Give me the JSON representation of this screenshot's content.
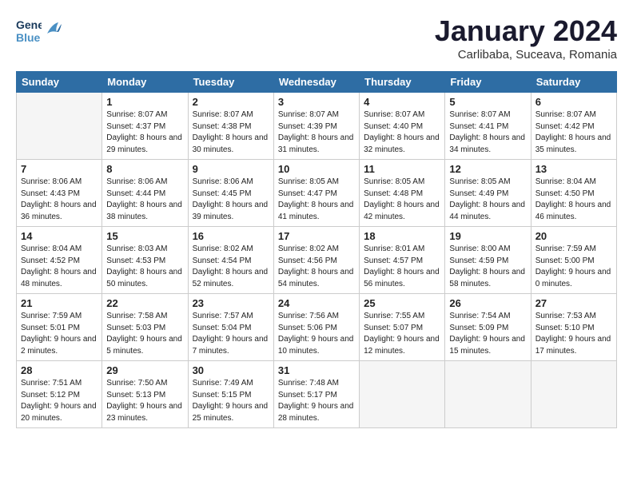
{
  "header": {
    "logo_general": "General",
    "logo_blue": "Blue",
    "month_title": "January 2024",
    "subtitle": "Carlibaba, Suceava, Romania"
  },
  "weekdays": [
    "Sunday",
    "Monday",
    "Tuesday",
    "Wednesday",
    "Thursday",
    "Friday",
    "Saturday"
  ],
  "weeks": [
    [
      {
        "day": "",
        "empty": true
      },
      {
        "day": "1",
        "sunrise": "Sunrise: 8:07 AM",
        "sunset": "Sunset: 4:37 PM",
        "daylight": "Daylight: 8 hours and 29 minutes."
      },
      {
        "day": "2",
        "sunrise": "Sunrise: 8:07 AM",
        "sunset": "Sunset: 4:38 PM",
        "daylight": "Daylight: 8 hours and 30 minutes."
      },
      {
        "day": "3",
        "sunrise": "Sunrise: 8:07 AM",
        "sunset": "Sunset: 4:39 PM",
        "daylight": "Daylight: 8 hours and 31 minutes."
      },
      {
        "day": "4",
        "sunrise": "Sunrise: 8:07 AM",
        "sunset": "Sunset: 4:40 PM",
        "daylight": "Daylight: 8 hours and 32 minutes."
      },
      {
        "day": "5",
        "sunrise": "Sunrise: 8:07 AM",
        "sunset": "Sunset: 4:41 PM",
        "daylight": "Daylight: 8 hours and 34 minutes."
      },
      {
        "day": "6",
        "sunrise": "Sunrise: 8:07 AM",
        "sunset": "Sunset: 4:42 PM",
        "daylight": "Daylight: 8 hours and 35 minutes."
      }
    ],
    [
      {
        "day": "7",
        "sunrise": "Sunrise: 8:06 AM",
        "sunset": "Sunset: 4:43 PM",
        "daylight": "Daylight: 8 hours and 36 minutes."
      },
      {
        "day": "8",
        "sunrise": "Sunrise: 8:06 AM",
        "sunset": "Sunset: 4:44 PM",
        "daylight": "Daylight: 8 hours and 38 minutes."
      },
      {
        "day": "9",
        "sunrise": "Sunrise: 8:06 AM",
        "sunset": "Sunset: 4:45 PM",
        "daylight": "Daylight: 8 hours and 39 minutes."
      },
      {
        "day": "10",
        "sunrise": "Sunrise: 8:05 AM",
        "sunset": "Sunset: 4:47 PM",
        "daylight": "Daylight: 8 hours and 41 minutes."
      },
      {
        "day": "11",
        "sunrise": "Sunrise: 8:05 AM",
        "sunset": "Sunset: 4:48 PM",
        "daylight": "Daylight: 8 hours and 42 minutes."
      },
      {
        "day": "12",
        "sunrise": "Sunrise: 8:05 AM",
        "sunset": "Sunset: 4:49 PM",
        "daylight": "Daylight: 8 hours and 44 minutes."
      },
      {
        "day": "13",
        "sunrise": "Sunrise: 8:04 AM",
        "sunset": "Sunset: 4:50 PM",
        "daylight": "Daylight: 8 hours and 46 minutes."
      }
    ],
    [
      {
        "day": "14",
        "sunrise": "Sunrise: 8:04 AM",
        "sunset": "Sunset: 4:52 PM",
        "daylight": "Daylight: 8 hours and 48 minutes."
      },
      {
        "day": "15",
        "sunrise": "Sunrise: 8:03 AM",
        "sunset": "Sunset: 4:53 PM",
        "daylight": "Daylight: 8 hours and 50 minutes."
      },
      {
        "day": "16",
        "sunrise": "Sunrise: 8:02 AM",
        "sunset": "Sunset: 4:54 PM",
        "daylight": "Daylight: 8 hours and 52 minutes."
      },
      {
        "day": "17",
        "sunrise": "Sunrise: 8:02 AM",
        "sunset": "Sunset: 4:56 PM",
        "daylight": "Daylight: 8 hours and 54 minutes."
      },
      {
        "day": "18",
        "sunrise": "Sunrise: 8:01 AM",
        "sunset": "Sunset: 4:57 PM",
        "daylight": "Daylight: 8 hours and 56 minutes."
      },
      {
        "day": "19",
        "sunrise": "Sunrise: 8:00 AM",
        "sunset": "Sunset: 4:59 PM",
        "daylight": "Daylight: 8 hours and 58 minutes."
      },
      {
        "day": "20",
        "sunrise": "Sunrise: 7:59 AM",
        "sunset": "Sunset: 5:00 PM",
        "daylight": "Daylight: 9 hours and 0 minutes."
      }
    ],
    [
      {
        "day": "21",
        "sunrise": "Sunrise: 7:59 AM",
        "sunset": "Sunset: 5:01 PM",
        "daylight": "Daylight: 9 hours and 2 minutes."
      },
      {
        "day": "22",
        "sunrise": "Sunrise: 7:58 AM",
        "sunset": "Sunset: 5:03 PM",
        "daylight": "Daylight: 9 hours and 5 minutes."
      },
      {
        "day": "23",
        "sunrise": "Sunrise: 7:57 AM",
        "sunset": "Sunset: 5:04 PM",
        "daylight": "Daylight: 9 hours and 7 minutes."
      },
      {
        "day": "24",
        "sunrise": "Sunrise: 7:56 AM",
        "sunset": "Sunset: 5:06 PM",
        "daylight": "Daylight: 9 hours and 10 minutes."
      },
      {
        "day": "25",
        "sunrise": "Sunrise: 7:55 AM",
        "sunset": "Sunset: 5:07 PM",
        "daylight": "Daylight: 9 hours and 12 minutes."
      },
      {
        "day": "26",
        "sunrise": "Sunrise: 7:54 AM",
        "sunset": "Sunset: 5:09 PM",
        "daylight": "Daylight: 9 hours and 15 minutes."
      },
      {
        "day": "27",
        "sunrise": "Sunrise: 7:53 AM",
        "sunset": "Sunset: 5:10 PM",
        "daylight": "Daylight: 9 hours and 17 minutes."
      }
    ],
    [
      {
        "day": "28",
        "sunrise": "Sunrise: 7:51 AM",
        "sunset": "Sunset: 5:12 PM",
        "daylight": "Daylight: 9 hours and 20 minutes."
      },
      {
        "day": "29",
        "sunrise": "Sunrise: 7:50 AM",
        "sunset": "Sunset: 5:13 PM",
        "daylight": "Daylight: 9 hours and 23 minutes."
      },
      {
        "day": "30",
        "sunrise": "Sunrise: 7:49 AM",
        "sunset": "Sunset: 5:15 PM",
        "daylight": "Daylight: 9 hours and 25 minutes."
      },
      {
        "day": "31",
        "sunrise": "Sunrise: 7:48 AM",
        "sunset": "Sunset: 5:17 PM",
        "daylight": "Daylight: 9 hours and 28 minutes."
      },
      {
        "day": "",
        "empty": true
      },
      {
        "day": "",
        "empty": true
      },
      {
        "day": "",
        "empty": true
      }
    ]
  ]
}
